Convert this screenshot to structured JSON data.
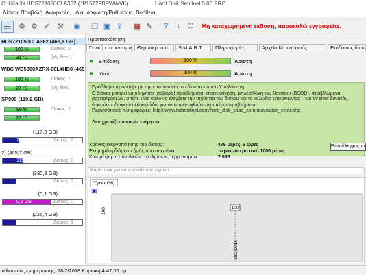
{
  "window": {
    "title_left": "C: Hitachi HDS721050CLA362 (JP1572FBPWWVK)",
    "title_right": "Hard Disk Sentinel 5.00 PRO"
  },
  "menu": [
    "Δίσκος",
    "Προβολή",
    "Αναφορές",
    "Διαμόρφωση/Ρυθμίσεις",
    "Βοήθεια"
  ],
  "toolbar": {
    "register_text": "Μη καταχωρημένη έκδοση, παρακαλώ εγγραφείτε."
  },
  "disks": [
    {
      "name": "HDS721050CLA362 (465,8 GB)",
      "health": "100 %",
      "health_pct": 100,
      "right_label": "Δίσκος: 0",
      "temp": "31 °C",
      "temp_label": "[My files 1]",
      "volume_text": "",
      "free_text": ""
    },
    {
      "name": "WDC WD5000AZRX-00L4HB0 (465,8 GB)",
      "health": "100 %",
      "health_pct": 100,
      "right_label": "Δίσκος: 1",
      "temp": "27 °C",
      "temp_label": "[My files]",
      "volume_text": "",
      "free_text": ""
    },
    {
      "name": "SP900 (119,2 GB)",
      "health": "99 %",
      "health_pct": 99,
      "right_label": "Δίσκος: 2",
      "temp": "27 °C",
      "temp_label": "",
      "volume_text": "",
      "free_text": ""
    }
  ],
  "volumes": [
    {
      "header": "(117,9 GB)",
      "used": "24,8 GB",
      "used_pct": 21,
      "free": "Δίσκος: 2",
      "color": "#1a1a9a"
    },
    {
      "header": "2)  (465,7 GB)",
      "used": "115,4 GB",
      "used_pct": 25,
      "free": "Δίσκος: 0",
      "color": "#1a1a9a"
    },
    {
      "header": "(330,8 GB)",
      "used": "53,5 GB",
      "used_pct": 16,
      "free": "Δίσκος: 1",
      "color": "#1a1a9a"
    },
    {
      "header": "(0,1 GB)",
      "used": "0,1 GB",
      "used_pct": 60,
      "free": "Δίσκος: 0",
      "color": "#c020c0"
    },
    {
      "header": "(225,4 GB)",
      "used": "37,9 GB",
      "used_pct": 17,
      "free": "Δίσκος: 1",
      "color": "#1a1a9a"
    }
  ],
  "right": {
    "overview_label": "Προεπισκόπηση",
    "tabs": [
      "Γενική επισκόπηση",
      "Θερμοκρασία",
      "S.M.A.R.T.",
      "Πληροφορίες",
      "Αρχείο Καταγραφής",
      "Επιδόσεις δίσκ"
    ],
    "performance_label": "Επίδοση:",
    "performance_value": "100 %",
    "performance_pct": 100,
    "performance_rating": "Άριστη",
    "health_label": "Υγεία:",
    "health_value": "100 %",
    "health_pct": 100,
    "health_rating": "Άριστη",
    "message": [
      "Πρόβλημα προέκυψε με την επικοινωνία του δίσκου και του Υπολογιστή.",
      "Ο δίσκος μπορεί να οδηγήσει (σοβαρά) προβλήματα, επανεκκίνηση, μπλε οθόνη-του-θανάτου (BSOD), στρεβλωμένα",
      "αρχεία/φάκελοι, οπότε είναι καλό να ελέγξετε την ταχύτητα του δίσκου και το καλώδιο επικοινωνίας – και αν είναι δυνατόν,",
      "δοκιμάστε διαφορετικό καλώδιο για να αποφευχθούν περαιτέρω προβλήματα.",
      "Περισσότερες πληροφορίες:  http://www.hdsentinel.com/hard_disk_case_communication_error.php"
    ],
    "message_bold": "Δεν χρειάζεται καμία ενέργεια.",
    "stats": [
      {
        "label": "Χρόνος ενεργοποίησης του δίσκου:",
        "value": "479 μέρες, 3 ώρες"
      },
      {
        "label": "Εκτιμημένη διάρκεια ζωής που απομένει:",
        "value": "περισσότερο από 1000 μέρες"
      },
      {
        "label": "Καταμέτρηση συνολικών σφαλμάτων, τερματισμών:",
        "value": "7.095"
      }
    ],
    "perf_button": "Επανέλεγχος του",
    "comment_placeholder": "Κάντε κλικ για να προσθέσετε σχόλιο ...",
    "chart_tab": "Υγεία (%)"
  },
  "chart_data": {
    "type": "line",
    "title": "",
    "x": [
      "18/2/2018"
    ],
    "series": [
      {
        "values": [
          100
        ]
      }
    ],
    "yticks": [
      "100"
    ],
    "data_labels": [
      "100"
    ]
  },
  "statusbar": {
    "text": "τελευταίος ενημέρωσης: 18/2/2018 Κυριακή 4:47:06 μμ"
  },
  "colors": {
    "accent_green": "#3cb93c",
    "message_bg": "#c8e6a8",
    "register_red": "#d40000",
    "volume_blue": "#1a1a9a",
    "volume_magenta": "#c020c0"
  }
}
